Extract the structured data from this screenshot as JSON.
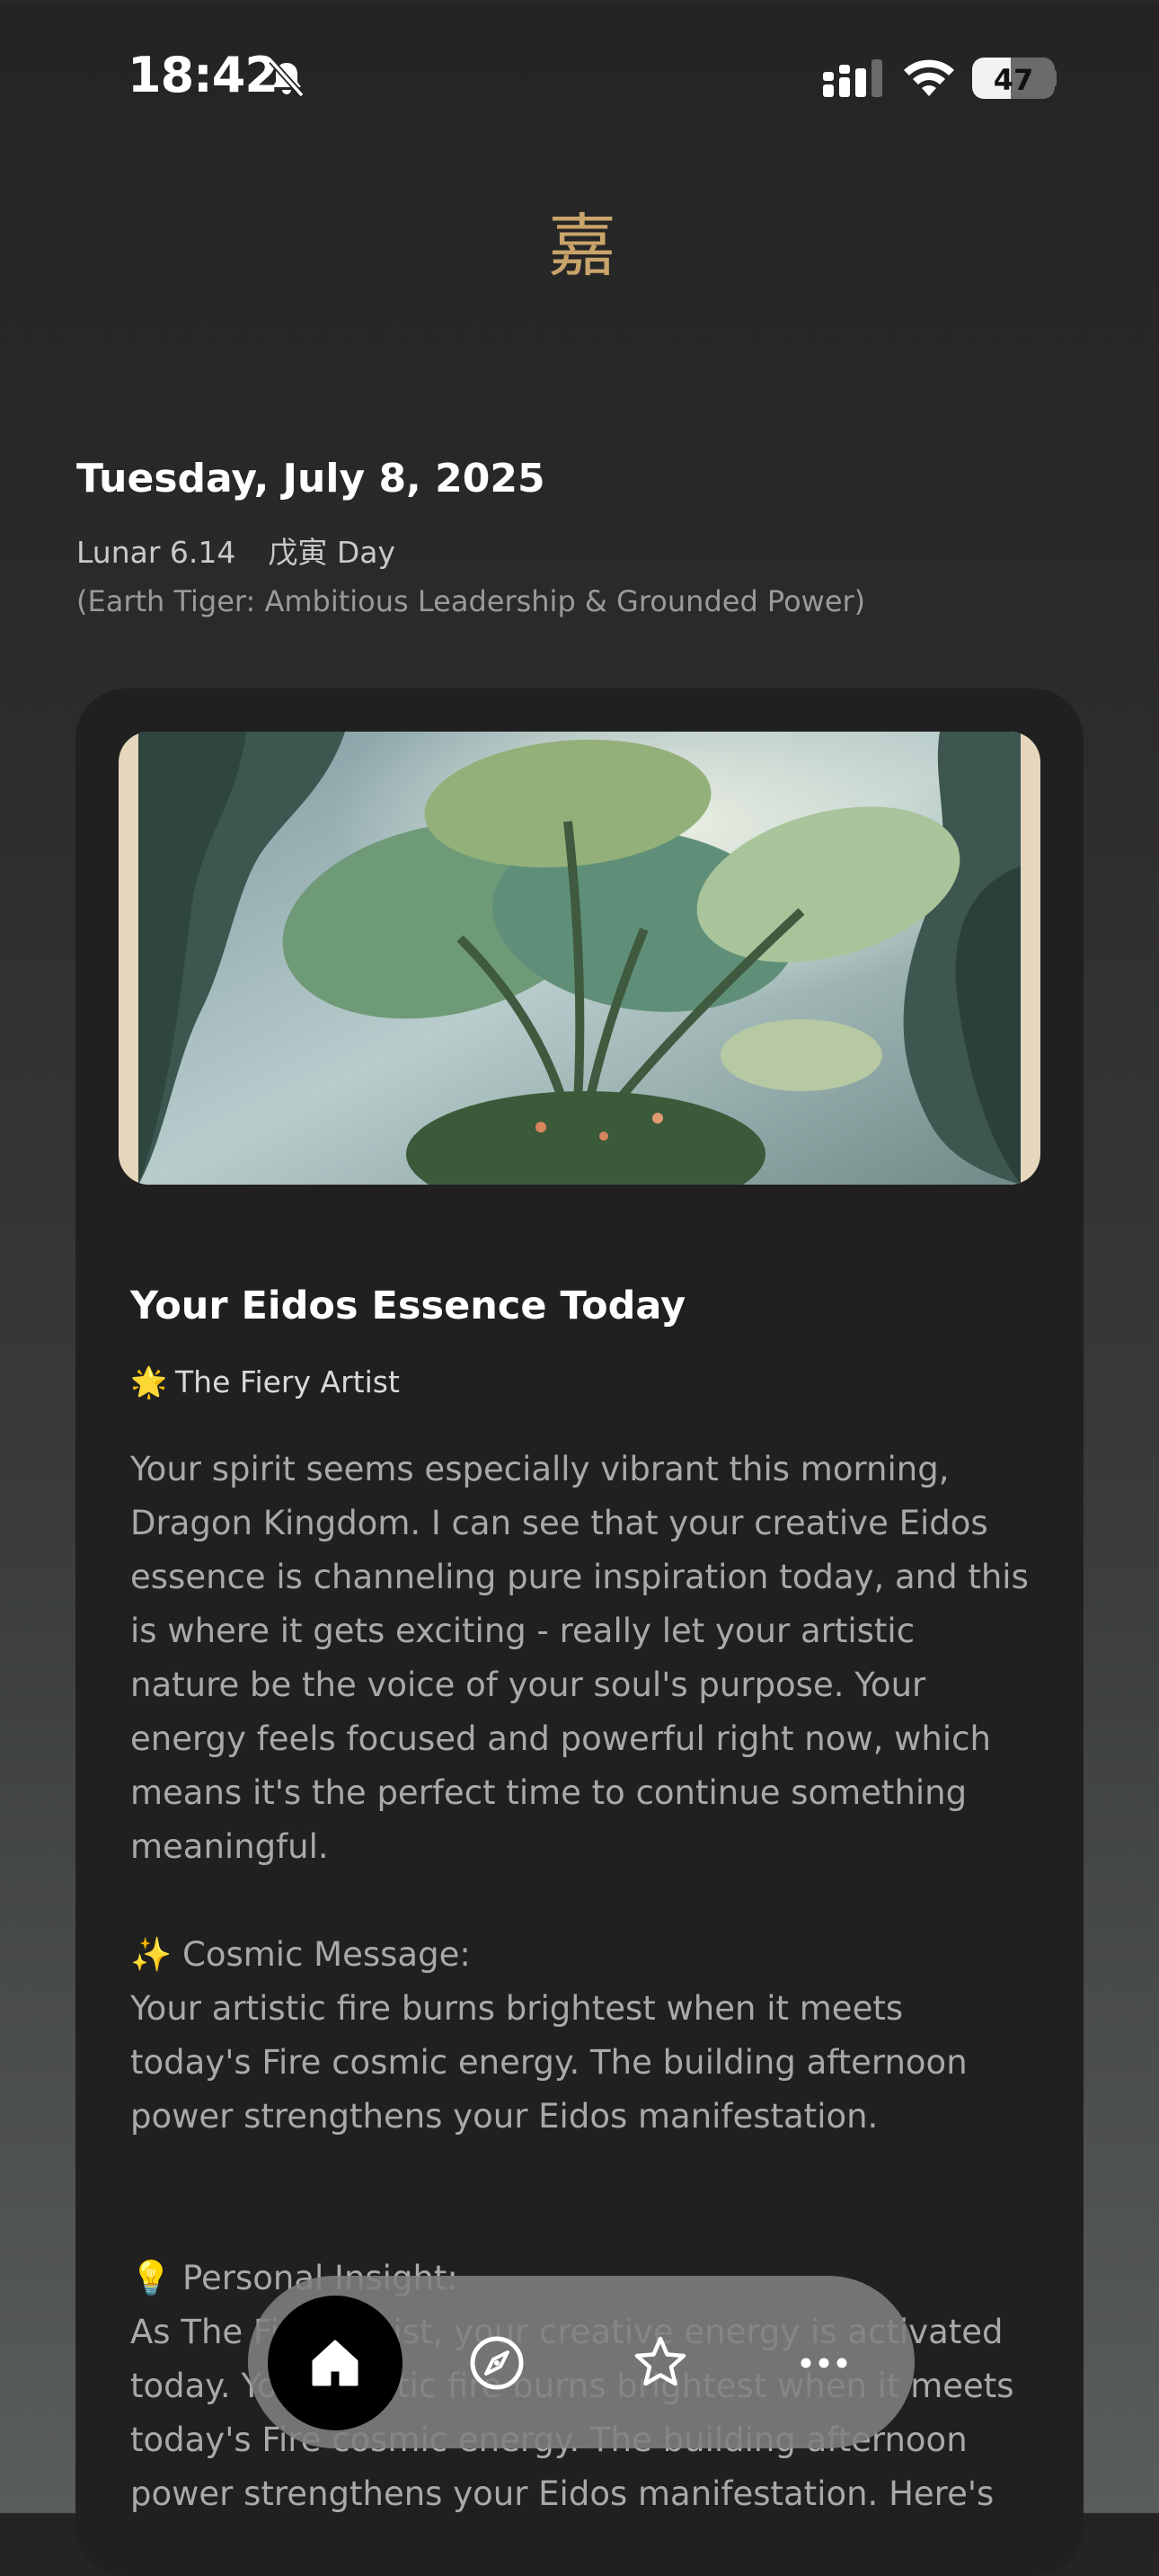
{
  "status_bar": {
    "time": "18:42",
    "battery_level": "47",
    "icons": [
      "bell-slash-icon",
      "cellular-signal-icon",
      "wifi-icon",
      "battery-icon"
    ]
  },
  "logo": {
    "glyph": "嘉"
  },
  "date": {
    "title": "Tuesday, July 8, 2025",
    "lunar": "Lunar 6.14",
    "day_pillar": "戊寅 Day",
    "description": "(Earth Tiger: Ambitious Leadership & Grounded Power)"
  },
  "card": {
    "title": "Your Eidos Essence Today",
    "archetype": "The Fiery Artist",
    "archetype_icon": "🌟",
    "intro": "Your spirit seems especially vibrant this morning, Dragon Kingdom. I can see that your creative Eidos essence is channeling pure inspiration today, and this is where it gets exciting - really let your artistic nature be the voice of your soul's purpose. Your energy feels focused and powerful right now, which means it's the perfect time to continue something meaningful.",
    "cosmic_icon": "✨",
    "cosmic_heading": "Cosmic Message:",
    "cosmic_text": "Your artistic fire burns brightest when it meets today's Fire cosmic energy. The building afternoon power strengthens your Eidos manifestation.",
    "insight_icon": "💡",
    "insight_heading": "Personal Insight:",
    "insight_text": "As The Fiery Artist, your creative energy is activated today. Your artistic fire burns brightest when it meets today's Fire cosmic energy. The building afternoon power strengthens your Eidos manifestation. Here's"
  },
  "tabbar": {
    "tabs": [
      {
        "name": "home",
        "icon": "home-icon",
        "active": true
      },
      {
        "name": "explore",
        "icon": "compass-icon",
        "active": false
      },
      {
        "name": "favorites",
        "icon": "star-icon",
        "active": false
      },
      {
        "name": "more",
        "icon": "more-icon",
        "active": false
      }
    ]
  },
  "colors": {
    "accent_gold": "#c9a46a",
    "card_bg": "#202020",
    "background": "#242424"
  }
}
